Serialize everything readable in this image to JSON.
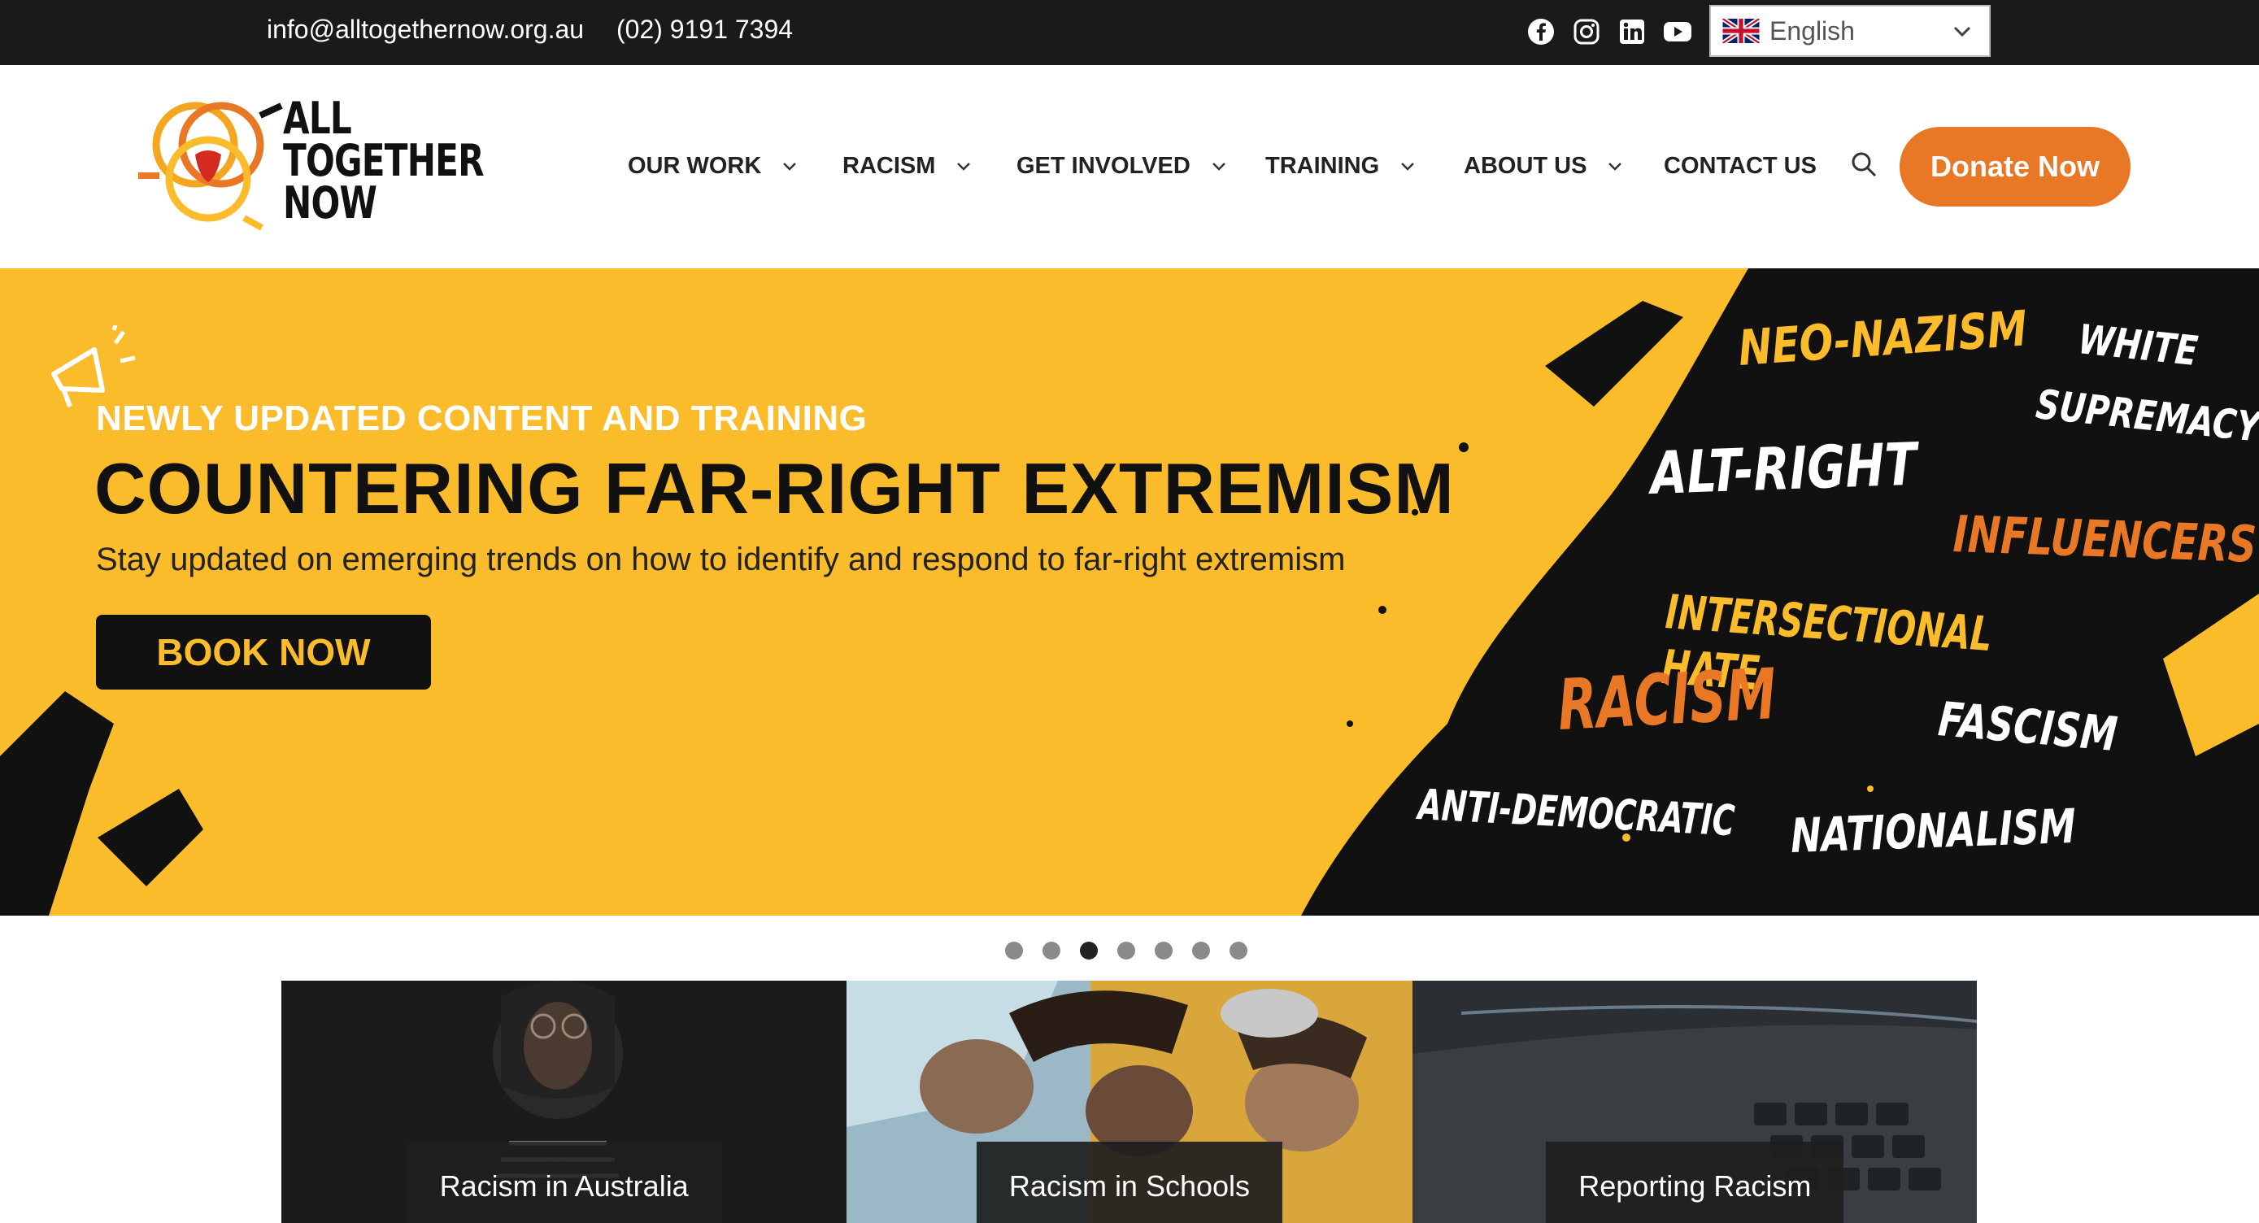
{
  "topbar": {
    "email": "info@alltogethernow.org.au",
    "phone": "(02) 9191 7394",
    "social_icons": [
      "facebook-icon",
      "instagram-icon",
      "linkedin-icon",
      "youtube-icon"
    ],
    "language": "English"
  },
  "logo": {
    "line1": "ALL",
    "line2": "TOGETHER",
    "line3": "NOW"
  },
  "nav": {
    "items": [
      {
        "label": "OUR WORK",
        "has_dropdown": true
      },
      {
        "label": "RACISM",
        "has_dropdown": true
      },
      {
        "label": "GET INVOLVED",
        "has_dropdown": true
      },
      {
        "label": "TRAINING",
        "has_dropdown": true
      },
      {
        "label": "ABOUT US",
        "has_dropdown": true
      },
      {
        "label": "CONTACT US",
        "has_dropdown": false
      }
    ],
    "donate_label": "Donate Now"
  },
  "hero": {
    "kicker": "NEWLY UPDATED CONTENT AND TRAINING",
    "title": "COUNTERING FAR-RIGHT EXTREMISM",
    "subtitle": "Stay updated on emerging trends on how to identify and respond to far-right extremism",
    "button_label": "BOOK NOW",
    "words": [
      "NEO-NAZISM",
      "WHITE",
      "SUPREMACY",
      "ALT-RIGHT",
      "INFLUENCERS",
      "INTERSECTIONAL HATE",
      "RACISM",
      "FASCISM",
      "ANTI-DEMOCRATIC",
      "NATIONALISM"
    ]
  },
  "carousel": {
    "slide_count": 7,
    "active_index": 2
  },
  "cards": [
    {
      "label": "Racism in Australia"
    },
    {
      "label": "Racism in Schools"
    },
    {
      "label": "Reporting Racism"
    }
  ],
  "colors": {
    "brand_orange": "#e97826",
    "hero_yellow": "#fbbc2c",
    "topbar": "#1a1a1a"
  }
}
